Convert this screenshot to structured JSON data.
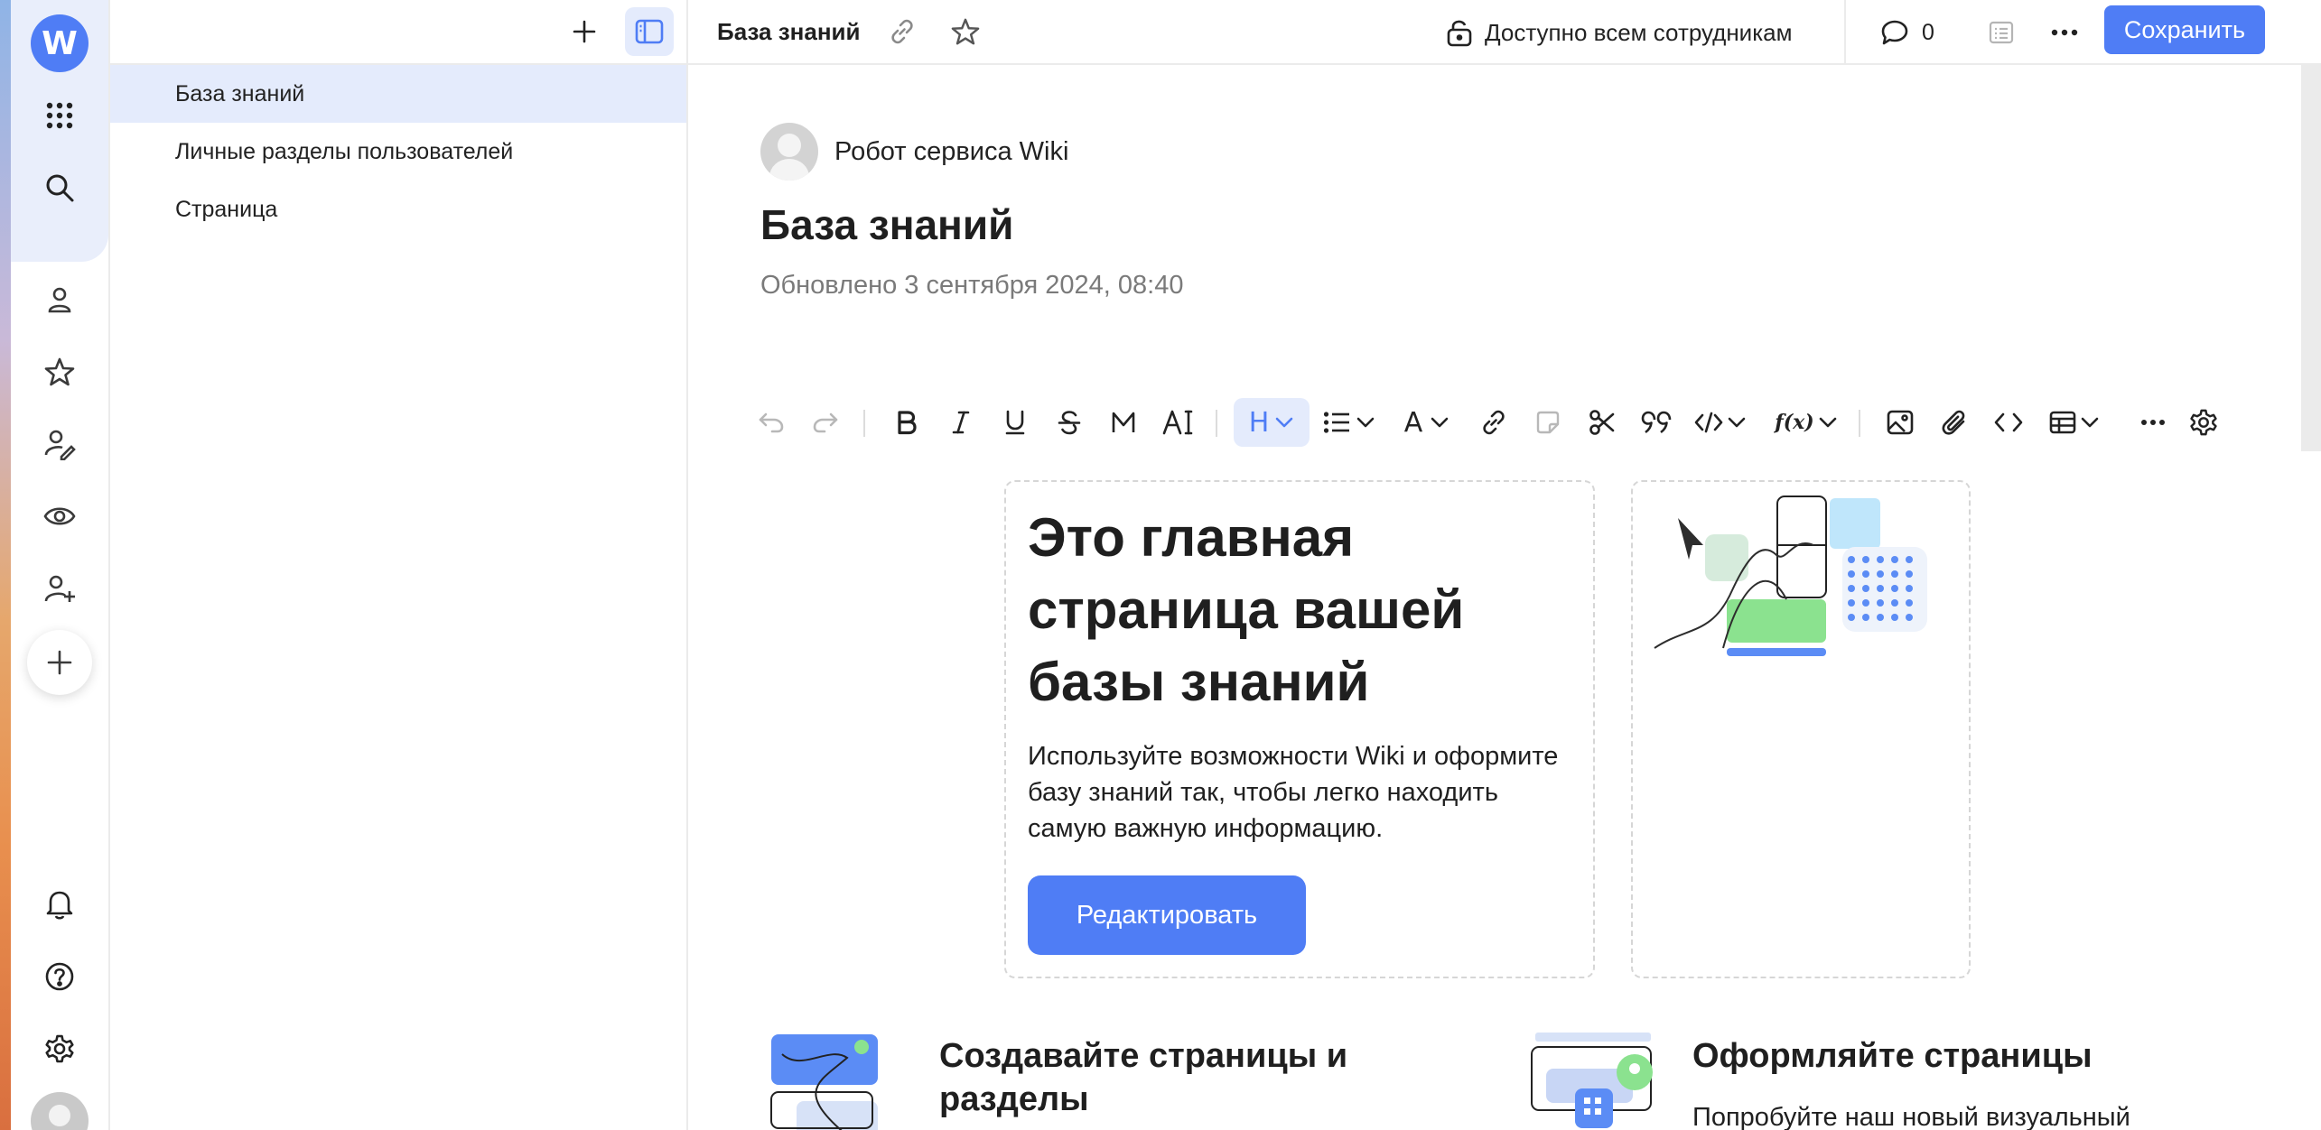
{
  "rail": {
    "logo_letter": "W",
    "icons": [
      "apps-grid-icon",
      "search-icon",
      "person-icon",
      "star-icon",
      "person-edit-icon",
      "eye-icon",
      "person-add-icon",
      "plus-icon",
      "bell-icon",
      "help-icon",
      "gear-icon",
      "avatar"
    ]
  },
  "sidebar": {
    "items": [
      {
        "label": "База знаний",
        "selected": true
      },
      {
        "label": "Личные разделы пользователей",
        "selected": false
      },
      {
        "label": "Страница",
        "selected": false
      }
    ]
  },
  "topbar": {
    "breadcrumb": "База знаний",
    "access_label": "Доступно всем сотрудникам",
    "comments_count": "0",
    "save_label": "Сохранить"
  },
  "page": {
    "author": "Робот сервиса Wiki",
    "title": "База знаний",
    "updated": "Обновлено 3 сентября 2024, 08:40"
  },
  "toolbar": {
    "heading_label": "H",
    "text_label": "A",
    "function_label": "f(x)"
  },
  "hero": {
    "title": "Это главная страница вашей базы знаний",
    "text": "Используйте возможности Wiki и оформите базу знаний так, чтобы легко находить самую важную информацию.",
    "button_label": "Редактировать"
  },
  "features": [
    {
      "title": "Создавайте страницы и разделы",
      "text": ""
    },
    {
      "title": "Оформляйте страницы",
      "text": "Попробуйте наш новый визуальный"
    }
  ],
  "colors": {
    "accent": "#4f7df5",
    "selected_bg": "#e4ebfc",
    "border": "#ebebeb"
  }
}
